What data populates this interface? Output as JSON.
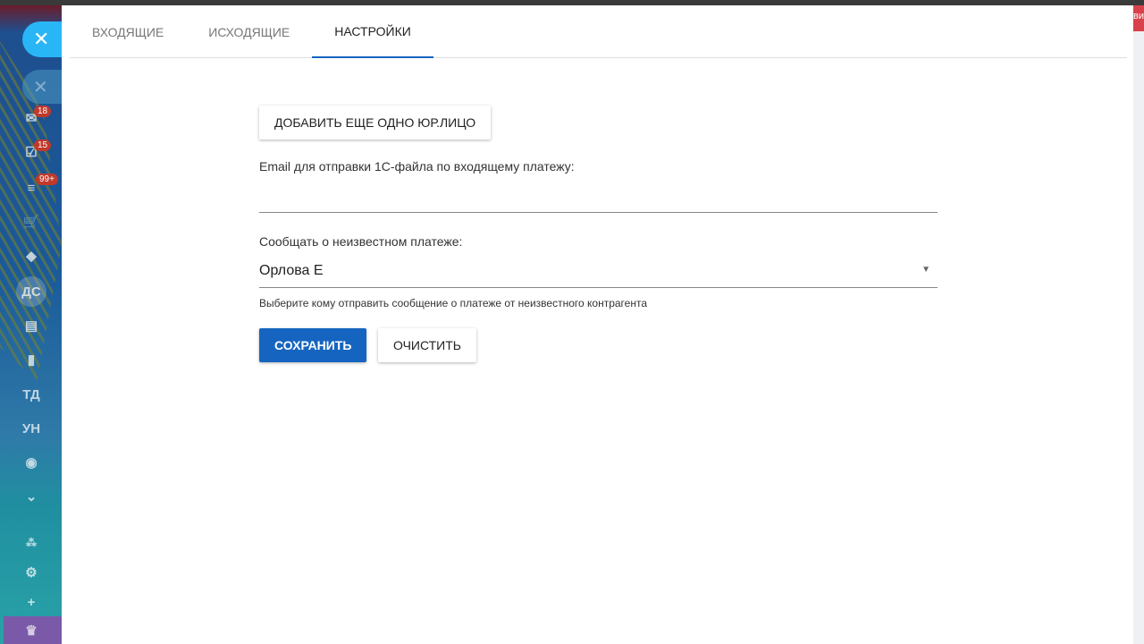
{
  "sidebar": {
    "badges": {
      "mail": "18",
      "tasks": "15",
      "filter": "99+"
    },
    "items": {
      "ds": "ДС",
      "td": "ТД",
      "un": "УН"
    }
  },
  "right_tag": "ви",
  "tabs": [
    "ВХОДЯЩИЕ",
    "ИСХОДЯЩИЕ",
    "НАСТРОЙКИ"
  ],
  "form": {
    "add_entity_label": "ДОБАВИТЬ ЕЩЕ ОДНО ЮР.ЛИЦО",
    "email_label": "Email для отправки 1С-файла по входящему платежу:",
    "email_value": "",
    "notify_label": "Сообщать о неизвестном платеже:",
    "notify_value": "Орлова Е",
    "notify_hint": "Выберите кому отправить сообщение о платеже от неизвестного контрагента",
    "save_label": "СОХРАНИТЬ",
    "clear_label": "ОЧИСТИТЬ"
  }
}
